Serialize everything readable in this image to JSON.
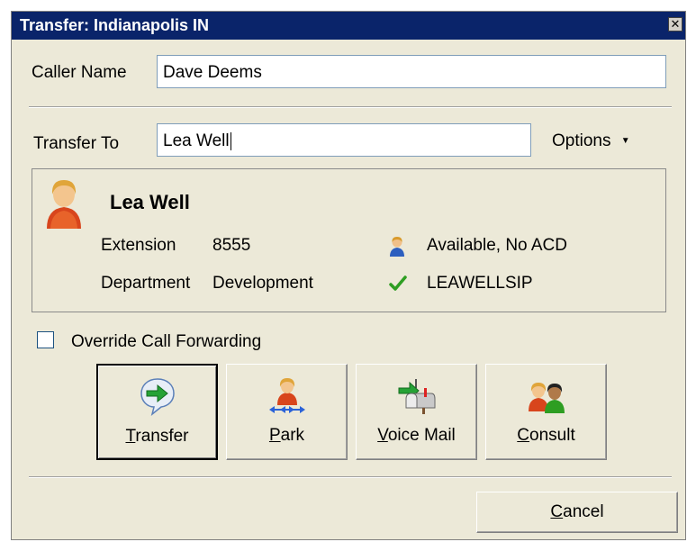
{
  "window": {
    "title": "Transfer: Indianapolis IN",
    "close_glyph": "✕"
  },
  "caller": {
    "label": "Caller Name",
    "value": "Dave Deems"
  },
  "transfer_to": {
    "label": "Transfer To",
    "value": "Lea Well"
  },
  "options": {
    "label": "Options",
    "arrow": "▼"
  },
  "contact": {
    "name": "Lea Well",
    "extension_label": "Extension",
    "extension": "8555",
    "department_label": "Department",
    "department": "Development",
    "status": "Available, No ACD",
    "station": "LEAWELLSIP"
  },
  "override": {
    "label": "Override Call Forwarding",
    "checked": false
  },
  "actions": [
    {
      "first": "T",
      "rest": "ransfer",
      "icon": "transfer-arrow-icon"
    },
    {
      "first": "P",
      "rest": "ark",
      "icon": "park-icon"
    },
    {
      "first": "V",
      "rest": "oice Mail",
      "icon": "voicemail-icon"
    },
    {
      "first": "C",
      "rest": "onsult",
      "icon": "consult-icon"
    }
  ],
  "cancel": {
    "first": "C",
    "rest": "ancel"
  },
  "colors": {
    "titlebar": "#0a246a",
    "dialog": "#ece9d8",
    "check_green": "#2e9e22"
  }
}
